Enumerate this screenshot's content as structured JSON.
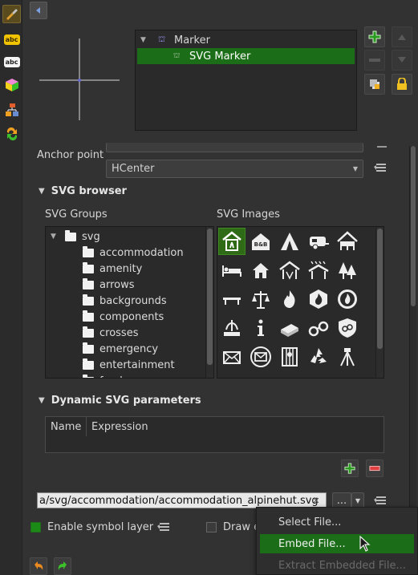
{
  "symbol_tree": {
    "root_label": "Marker",
    "child_label": "SVG Marker"
  },
  "anchor": {
    "label": "Anchor point",
    "value": "HCenter"
  },
  "svg_browser": {
    "title": "SVG browser",
    "groups_label": "SVG Groups",
    "images_label": "SVG Images",
    "root_group": "svg",
    "groups": [
      "accommodation",
      "amenity",
      "arrows",
      "backgrounds",
      "components",
      "crosses",
      "emergency",
      "entertainment",
      "food"
    ]
  },
  "dynamic_params": {
    "title": "Dynamic SVG parameters",
    "col_name": "Name",
    "col_expression": "Expression"
  },
  "file": {
    "path": "a/svg/accommodation/accommodation_alpinehut.svg",
    "browse_label": "..."
  },
  "enable_layer": {
    "label": "Enable symbol layer",
    "checked": true
  },
  "draw_effects": {
    "label": "Draw e",
    "checked": false
  },
  "file_menu": {
    "items": [
      "Select File...",
      "Embed File...",
      "Extract Embedded File..."
    ],
    "highlighted": "Embed File..."
  },
  "colors": {
    "accent_green": "#1b6e17",
    "background": "#323232"
  }
}
